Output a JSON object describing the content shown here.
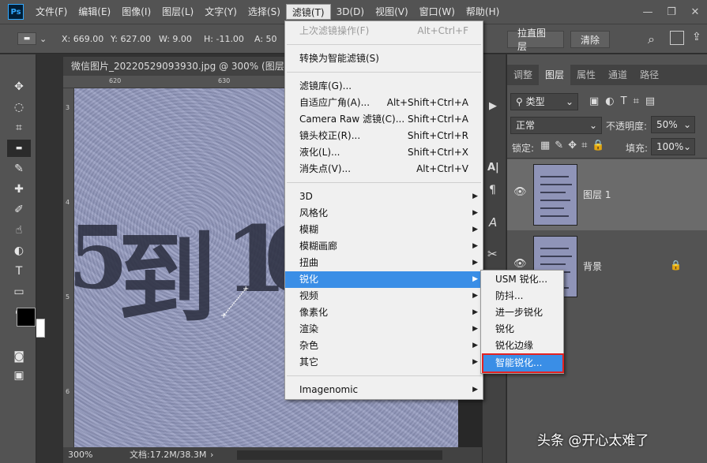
{
  "app": {
    "logo": "Ps"
  },
  "menubar": {
    "items": [
      "文件(F)",
      "编辑(E)",
      "图像(I)",
      "图层(L)",
      "文字(Y)",
      "选择(S)",
      "滤镜(T)",
      "3D(D)",
      "视图(V)",
      "窗口(W)",
      "帮助(H)"
    ],
    "active": "滤镜(T)"
  },
  "window_controls": {
    "minimize": "—",
    "restore": "❐",
    "close": "✕"
  },
  "options_bar": {
    "x": "X: 669.00",
    "y": "Y: 627.00",
    "w": "W: 9.00",
    "h": "H: -11.00",
    "a": "A: 50",
    "straighten_button": "拉直图层",
    "clear_button": "清除"
  },
  "document": {
    "tab_title": "微信图片_20220529093930.jpg @ 300% (图层 1, R",
    "ruler_top_ticks": [
      "620",
      "630"
    ],
    "ruler_left_ticks": [
      "3",
      "4",
      "5",
      "6"
    ],
    "canvas_text": [
      "5",
      "到",
      "1",
      "0"
    ],
    "status_zoom": "300%",
    "status_doc": "文档:17.2M/38.3M"
  },
  "filter_menu": {
    "items": [
      {
        "label": "上次滤镜操作(F)",
        "shortcut": "Alt+Ctrl+F",
        "disabled": true
      },
      {
        "label": "转换为智能滤镜(S)",
        "shortcut": ""
      },
      {
        "label": "滤镜库(G)...",
        "shortcut": ""
      },
      {
        "label": "自适应广角(A)...",
        "shortcut": "Alt+Shift+Ctrl+A"
      },
      {
        "label": "Camera Raw 滤镜(C)...",
        "shortcut": "Shift+Ctrl+A"
      },
      {
        "label": "镜头校正(R)...",
        "shortcut": "Shift+Ctrl+R"
      },
      {
        "label": "液化(L)...",
        "shortcut": "Shift+Ctrl+X"
      },
      {
        "label": "消失点(V)...",
        "shortcut": "Alt+Ctrl+V"
      },
      {
        "label": "3D",
        "submenu": true
      },
      {
        "label": "风格化",
        "submenu": true
      },
      {
        "label": "模糊",
        "submenu": true
      },
      {
        "label": "模糊画廊",
        "submenu": true
      },
      {
        "label": "扭曲",
        "submenu": true
      },
      {
        "label": "锐化",
        "submenu": true,
        "hover": true
      },
      {
        "label": "视频",
        "submenu": true
      },
      {
        "label": "像素化",
        "submenu": true
      },
      {
        "label": "渲染",
        "submenu": true
      },
      {
        "label": "杂色",
        "submenu": true
      },
      {
        "label": "其它",
        "submenu": true
      },
      {
        "label": "Imagenomic",
        "submenu": true
      }
    ]
  },
  "sharpen_submenu": {
    "items": [
      "USM 锐化...",
      "防抖...",
      "进一步锐化",
      "锐化",
      "锐化边缘",
      "智能锐化..."
    ],
    "highlighted": "智能锐化..."
  },
  "layers_panel": {
    "tabs": [
      "调整",
      "图层",
      "属性",
      "通道",
      "路径"
    ],
    "active_tab": "图层",
    "filter_kind": "类型",
    "blend_mode": "正常",
    "opacity_label": "不透明度:",
    "opacity_value": "50%",
    "lock_label": "锁定:",
    "fill_label": "填充:",
    "fill_value": "100%",
    "layers": [
      {
        "name": "图层 1",
        "selected": true,
        "locked": false
      },
      {
        "name": "背景",
        "selected": false,
        "locked": true
      }
    ]
  },
  "watermark": "头条 @开心太难了",
  "colors": {
    "menu_highlight": "#3a8ee6",
    "highlight_border": "#e32222",
    "ui_dark": "#535353"
  }
}
